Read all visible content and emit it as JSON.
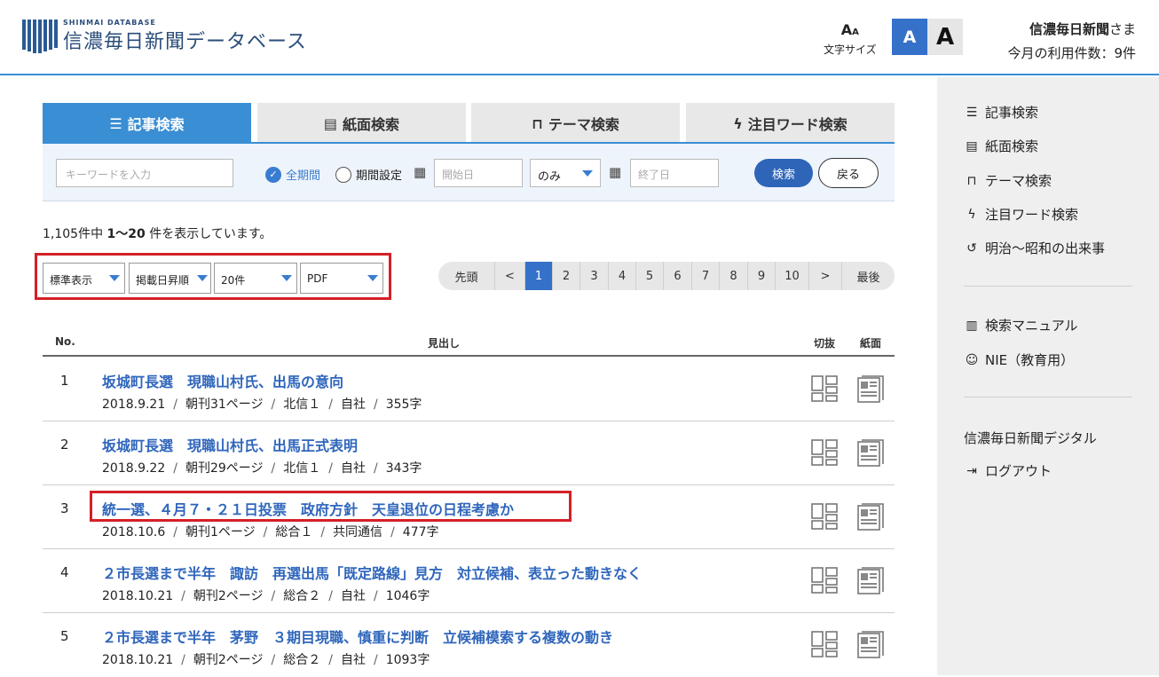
{
  "header": {
    "logo_sub": "SHINMAI DATABASE",
    "logo_main": "信濃毎日新聞データベース",
    "font_size_label": "文字サイズ",
    "font_small_label": "A",
    "font_large_label": "A",
    "user_name": "信濃毎日新聞",
    "user_suffix": "さま",
    "usage": "今月の利用件数：9件"
  },
  "tabs": [
    {
      "label": "記事検索",
      "icon": "list-icon"
    },
    {
      "label": "紙面検索",
      "icon": "newspaper-icon"
    },
    {
      "label": "テーマ検索",
      "icon": "bookmark-icon"
    },
    {
      "label": "注目ワード検索",
      "icon": "lightning-icon"
    }
  ],
  "search": {
    "keyword_placeholder": "キーワードを入力",
    "radio_all": "全期間",
    "radio_range": "期間設定",
    "start_placeholder": "開始日",
    "only_option": "のみ",
    "end_placeholder": "終了日",
    "search_button": "検索",
    "back_button": "戻る"
  },
  "results": {
    "total": "1,105件中",
    "range": "1〜20",
    "suffix": "件を表示しています。"
  },
  "display_options": {
    "view": "標準表示",
    "sort": "掲載日昇順",
    "per_page": "20件",
    "format": "PDF"
  },
  "pagination": {
    "first": "先頭",
    "prev": "<",
    "pages": [
      "1",
      "2",
      "3",
      "4",
      "5",
      "6",
      "7",
      "8",
      "9",
      "10"
    ],
    "current": "1",
    "next": ">",
    "last": "最後"
  },
  "table": {
    "col_no": "No.",
    "col_title": "見出し",
    "col_clip": "切抜",
    "col_paper": "紙面",
    "rows": [
      {
        "no": "1",
        "title": "坂城町長選　現職山村氏、出馬の意向",
        "date": "2018.9.21",
        "page": "朝刊31ページ",
        "section": "北信１",
        "source": "自社",
        "chars": "355字"
      },
      {
        "no": "2",
        "title": "坂城町長選　現職山村氏、出馬正式表明",
        "date": "2018.9.22",
        "page": "朝刊29ページ",
        "section": "北信１",
        "source": "自社",
        "chars": "343字"
      },
      {
        "no": "3",
        "title": "統一選、４月７・２１日投票　政府方針　天皇退位の日程考慮か",
        "date": "2018.10.6",
        "page": "朝刊1ページ",
        "section": "総合１",
        "source": "共同通信",
        "chars": "477字"
      },
      {
        "no": "4",
        "title": "２市長選まで半年　諏訪　再選出馬「既定路線」見方　対立候補、表立った動きなく",
        "date": "2018.10.21",
        "page": "朝刊2ページ",
        "section": "総合２",
        "source": "自社",
        "chars": "1046字"
      },
      {
        "no": "5",
        "title": "２市長選まで半年　茅野　３期目現職、慎重に判断　立候補模索する複数の動き",
        "date": "2018.10.21",
        "page": "朝刊2ページ",
        "section": "総合２",
        "source": "自社",
        "chars": "1093字"
      }
    ]
  },
  "sidebar": {
    "items": [
      {
        "label": "記事検索",
        "icon": "list-icon"
      },
      {
        "label": "紙面検索",
        "icon": "newspaper-icon"
      },
      {
        "label": "テーマ検索",
        "icon": "bookmark-icon"
      },
      {
        "label": "注目ワード検索",
        "icon": "lightning-icon"
      },
      {
        "label": "明治〜昭和の出来事",
        "icon": "history-icon"
      },
      {
        "label": "検索マニュアル",
        "icon": "book-icon"
      },
      {
        "label": "NIE（教育用）",
        "icon": "education-icon"
      },
      {
        "label": "信濃毎日新聞デジタル",
        "icon": ""
      },
      {
        "label": "ログアウト",
        "icon": "logout-icon"
      }
    ]
  },
  "colors": {
    "accent": "#3a8ed3",
    "link": "#2f66bc",
    "highlight_box": "#d42027"
  }
}
